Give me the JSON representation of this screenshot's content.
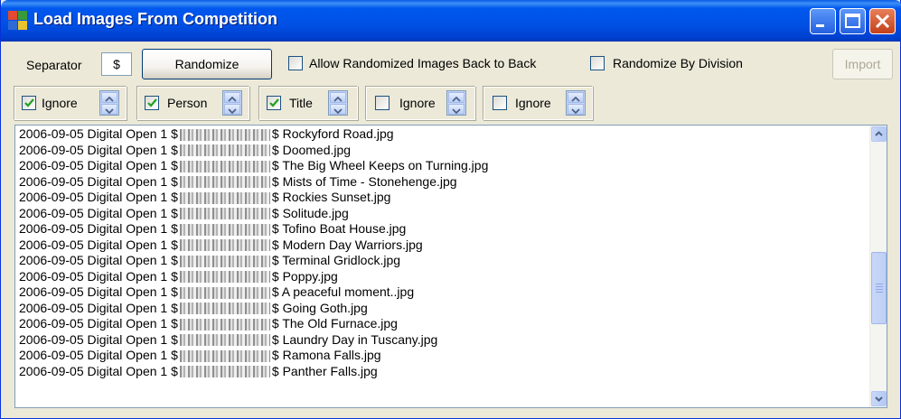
{
  "window": {
    "title": "Load Images From Competition",
    "controls": {
      "minimize_icon": "minimize-icon",
      "maximize_icon": "maximize-icon",
      "close_icon": "close-icon"
    }
  },
  "toolbar": {
    "separator_label": "Separator",
    "separator_value": "$",
    "randomize_label": "Randomize",
    "allow_back_to_back_label": "Allow Randomized Images Back to Back",
    "allow_back_to_back_checked": false,
    "randomize_by_division_label": "Randomize By Division",
    "randomize_by_division_checked": false,
    "import_label": "Import",
    "import_enabled": false
  },
  "fields": [
    {
      "label": "Ignore",
      "checked": true
    },
    {
      "label": "Person",
      "checked": true
    },
    {
      "label": "Title",
      "checked": true
    },
    {
      "label": "Ignore",
      "checked": false
    },
    {
      "label": "Ignore",
      "checked": false
    }
  ],
  "list": {
    "prefix": "2006-09-05 Digital Open 1 $",
    "items": [
      {
        "title": "$ Rockyford Road.jpg"
      },
      {
        "title": "$ Doomed.jpg"
      },
      {
        "title": "$ The Big Wheel Keeps on Turning.jpg"
      },
      {
        "title": "$ Mists of Time - Stonehenge.jpg"
      },
      {
        "title": "$ Rockies Sunset.jpg"
      },
      {
        "title": "$ Solitude.jpg"
      },
      {
        "title": "$ Tofino Boat House.jpg"
      },
      {
        "title": "$ Modern Day Warriors.jpg"
      },
      {
        "title": "$ Terminal Gridlock.jpg"
      },
      {
        "title": "$ Poppy.jpg"
      },
      {
        "title": "$ A peaceful moment..jpg"
      },
      {
        "title": "$ Going Goth.jpg"
      },
      {
        "title": "$ The Old Furnace.jpg"
      },
      {
        "title": "$ Laundry Day in Tuscany.jpg"
      },
      {
        "title": "$ Ramona Falls.jpg"
      },
      {
        "title": "$ Panther Falls.jpg"
      }
    ],
    "scroll_position": 0.62
  },
  "colors": {
    "titlebar": "#0054E3",
    "window_bg": "#ECE9D8",
    "close_button": "#D85B2E"
  }
}
